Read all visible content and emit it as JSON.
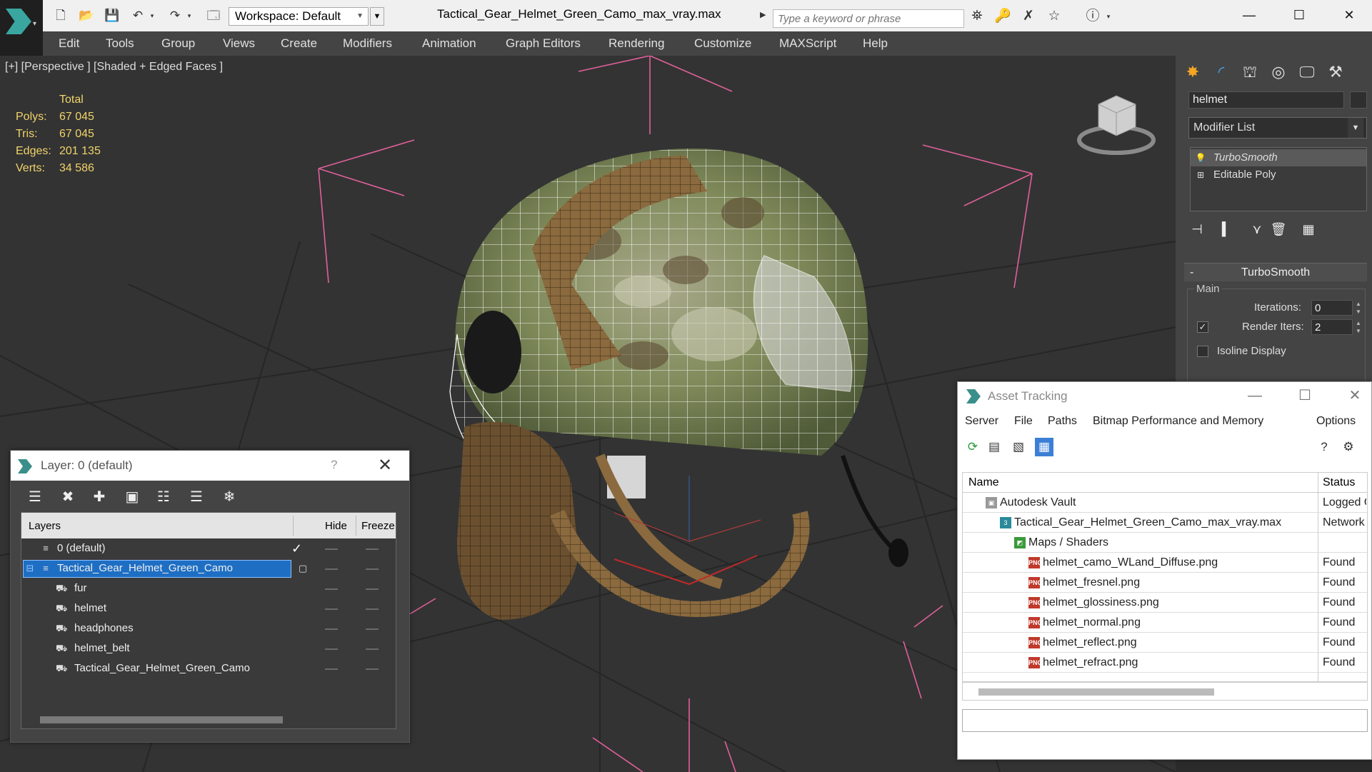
{
  "window": {
    "title": "Tactical_Gear_Helmet_Green_Camo_max_vray.max",
    "workspace": "Workspace: Default",
    "search_placeholder": "Type a keyword or phrase",
    "minimize": "—",
    "maximize": "☐",
    "close": "✕"
  },
  "menu": {
    "items": [
      "Edit",
      "Tools",
      "Group",
      "Views",
      "Create",
      "Modifiers",
      "Animation",
      "Graph Editors",
      "Rendering",
      "Customize",
      "MAXScript",
      "Help"
    ]
  },
  "viewport": {
    "label": "[+] [Perspective ] [Shaded + Edged Faces ]",
    "stats": {
      "header": "Total",
      "rows": [
        {
          "label": "Polys:",
          "value": "67 045"
        },
        {
          "label": "Tris:",
          "value": "67 045"
        },
        {
          "label": "Edges:",
          "value": "201 135"
        },
        {
          "label": "Verts:",
          "value": "34 586"
        }
      ]
    },
    "colors": {
      "grid": "#2a2a2a",
      "bbox": "#e0609a",
      "wire": "#ffffff",
      "camo_green": "#7f8a5a",
      "tan": "#9a7a4a"
    }
  },
  "command_panel": {
    "object_name": "helmet",
    "modifier_list": "Modifier List",
    "stack": [
      "TurboSmooth",
      "Editable Poly"
    ],
    "rollout": "TurboSmooth",
    "group": "Main",
    "iterations_label": "Iterations:",
    "iterations": "0",
    "render_iters_label": "Render Iters:",
    "render_iters": "2",
    "render_iters_checked": true,
    "isoline_label": "Isoline Display",
    "isoline_checked": false
  },
  "layer_panel": {
    "title": "Layer: 0 (default)",
    "help": "?",
    "columns": [
      "Layers",
      "Hide",
      "Freeze"
    ],
    "rows": [
      {
        "name": "0 (default)",
        "level": 0,
        "type": "layer",
        "current": true
      },
      {
        "name": "Tactical_Gear_Helmet_Green_Camo",
        "level": 0,
        "type": "layer",
        "selected": true,
        "expanded": true
      },
      {
        "name": "fur",
        "level": 1,
        "type": "object"
      },
      {
        "name": "helmet",
        "level": 1,
        "type": "object"
      },
      {
        "name": "headphones",
        "level": 1,
        "type": "object"
      },
      {
        "name": "helmet_belt",
        "level": 1,
        "type": "object"
      },
      {
        "name": "Tactical_Gear_Helmet_Green_Camo",
        "level": 1,
        "type": "object"
      }
    ]
  },
  "asset_panel": {
    "title": "Asset Tracking",
    "menu": [
      "Server",
      "File",
      "Paths",
      "Bitmap Performance and Memory",
      "Options"
    ],
    "columns": [
      "Name",
      "Status"
    ],
    "rows": [
      {
        "name": "Autodesk Vault",
        "status": "Logged Out",
        "icon": "vault",
        "level": 0
      },
      {
        "name": "Tactical_Gear_Helmet_Green_Camo_max_vray.max",
        "status": "Network",
        "icon": "max",
        "level": 1
      },
      {
        "name": "Maps / Shaders",
        "status": "",
        "icon": "maps",
        "level": 2
      },
      {
        "name": "helmet_camo_WLand_Diffuse.png",
        "status": "Found",
        "icon": "png",
        "level": 3
      },
      {
        "name": "helmet_fresnel.png",
        "status": "Found",
        "icon": "png",
        "level": 3
      },
      {
        "name": "helmet_glossiness.png",
        "status": "Found",
        "icon": "png",
        "level": 3
      },
      {
        "name": "helmet_normal.png",
        "status": "Found",
        "icon": "png",
        "level": 3
      },
      {
        "name": "helmet_reflect.png",
        "status": "Found",
        "icon": "png",
        "level": 3
      },
      {
        "name": "helmet_refract.png",
        "status": "Found",
        "icon": "png",
        "level": 3
      }
    ]
  }
}
